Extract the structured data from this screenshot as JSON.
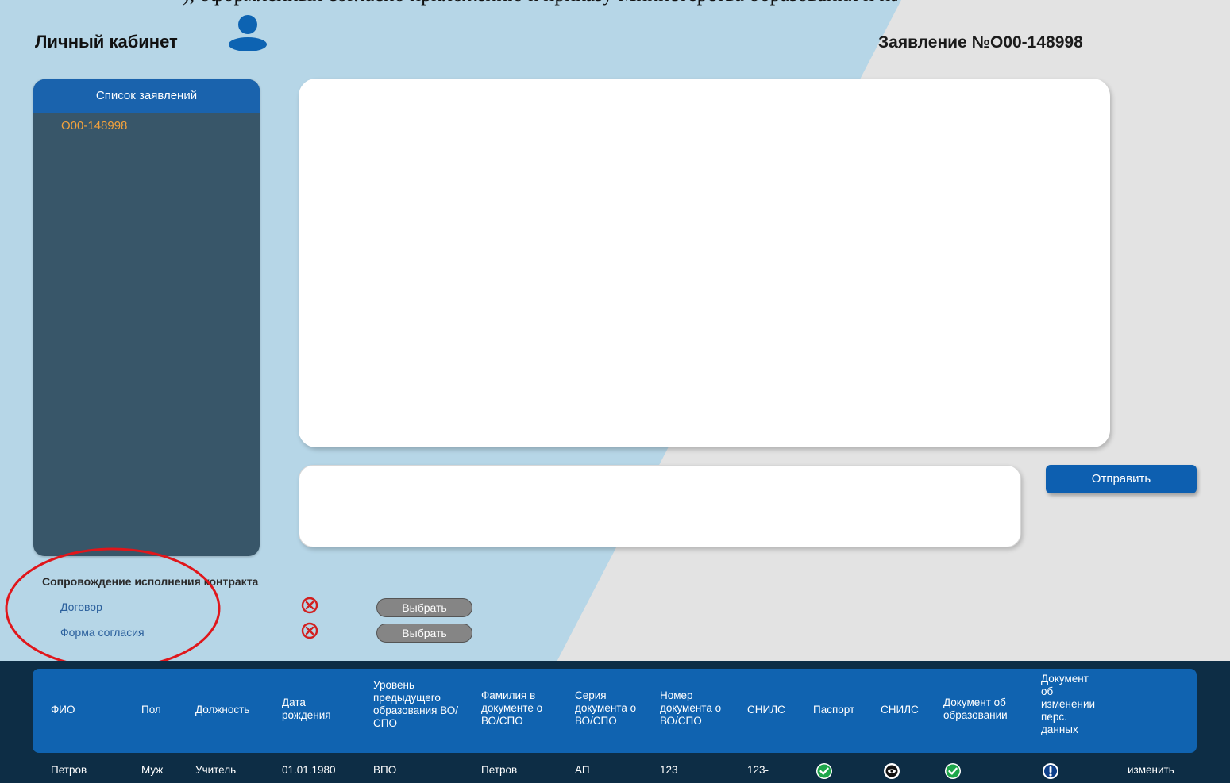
{
  "top_cut_text": "), оформленных согласно приложению к приказу Министерства образования и науки, и",
  "header": {
    "title": "Личный кабинет",
    "application_number": "Заявление №О00-148998"
  },
  "application_list": {
    "title": "Список заявлений",
    "items": [
      "О00-148998"
    ]
  },
  "chat": {
    "send_label": "Отправить",
    "message_value": ""
  },
  "contract_support": {
    "title": "Сопровождение исполнения контракта",
    "documents": [
      {
        "label": "Договор",
        "status": "missing",
        "button": "Выбрать"
      },
      {
        "label": "Форма согласия",
        "status": "missing",
        "button": "Выбрать"
      }
    ]
  },
  "table": {
    "columns": [
      "ФИО",
      "Пол",
      "Должность",
      "Дата рождения",
      "Уровень предыдущего образования ВО/СПО",
      "Фамилия в документе о ВО/СПО",
      "Серия документа о ВО/СПО",
      "Номер документа о ВО/СПО",
      "СНИЛС",
      "Паспорт",
      "СНИЛС",
      "Документ об образовании",
      "Документ об изменении перс. данных"
    ],
    "rows": [
      {
        "fio": "Петров",
        "sex": "Муж",
        "position": "Учитель",
        "birth_date": "01.01.1980",
        "edu_level": "ВПО",
        "doc_surname": "Петров",
        "doc_series": "АП",
        "doc_number": "123",
        "snils": "123-",
        "passport_icon": "check-circle-icon",
        "snils_icon": "eye-circle-icon",
        "education_doc_icon": "check-circle-icon",
        "change_doc_icon": "exclamation-circle-icon",
        "action": "изменить"
      }
    ]
  },
  "colors": {
    "accent_blue": "#1063b0",
    "sidebar": "#385669",
    "light_blue_bg": "#b6d6e7",
    "grey_bg": "#e3e3e3",
    "dark_band": "#0d2d45",
    "item_orange": "#f3a23c",
    "error_red": "#d21f1f",
    "ok_green": "#1ea64a"
  }
}
